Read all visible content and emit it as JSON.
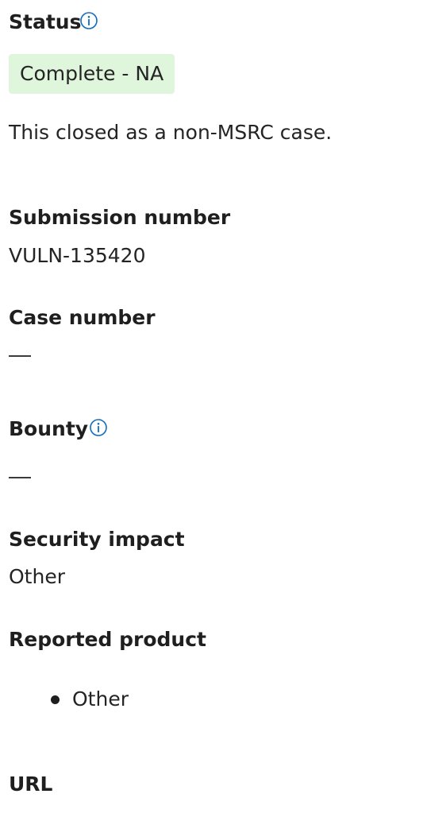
{
  "status": {
    "label": "Status",
    "badge": "Complete - NA",
    "description": "This closed as a non-MSRC case.",
    "info_icon": "info-icon"
  },
  "submission_number": {
    "label": "Submission number",
    "value": "VULN-135420"
  },
  "case_number": {
    "label": "Case number",
    "value": "—"
  },
  "bounty": {
    "label": "Bounty",
    "value": "—",
    "info_icon": "info-icon"
  },
  "security_impact": {
    "label": "Security impact",
    "value": "Other"
  },
  "reported_product": {
    "label": "Reported product",
    "items": [
      "Other"
    ]
  },
  "url": {
    "label": "URL"
  },
  "colors": {
    "badge_background": "#dff6dd",
    "info_icon": "#0f6cbd",
    "text": "#242424"
  }
}
